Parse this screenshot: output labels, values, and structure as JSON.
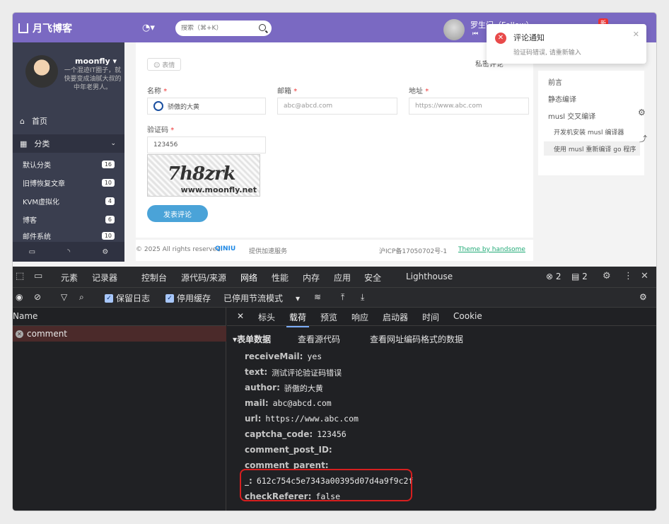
{
  "site": {
    "title": "月飞博客",
    "search_placeholder": "搜索（⌘+K）",
    "user_name": "罗生门（Follow）",
    "user_sub": "⏮",
    "new_badge": "新"
  },
  "sidebar": {
    "profile_name": "moonfly ▾",
    "profile_desc": "一个混迹IT圈子，就快要变成油腻大叔的中年老男人。",
    "home_label": "首页",
    "category_label": "分类",
    "categories": [
      {
        "name": "默认分类",
        "count": "16"
      },
      {
        "name": "旧博恢复文章",
        "count": "10"
      },
      {
        "name": "KVM虚拟化",
        "count": "4"
      },
      {
        "name": "博客",
        "count": "6"
      },
      {
        "name": "邮件系统",
        "count": "10"
      }
    ],
    "bottom_icons": [
      "comment-icon",
      "rss-icon",
      "gear-icon"
    ]
  },
  "form": {
    "emoji_label": "☺ 表情",
    "private_label": "私密评论",
    "name_label": "名称",
    "email_label": "邮箱",
    "url_label": "地址",
    "required_mark": "*",
    "name_value": "骄傲的大黄",
    "email_placeholder": "abc@abcd.com",
    "url_placeholder": "https://www.abc.com",
    "captcha_label": "验证码",
    "captcha_value": "123456",
    "captcha_code": "7h8zrk",
    "captcha_site": "www.moonfly.net",
    "submit_label": "发表评论"
  },
  "footer": {
    "copyright": "© 2025 All rights reserved.",
    "qiniu": "QINIU",
    "cdn_text": "提供加速服务",
    "icp": "沪ICP备17050702号-1",
    "theme": "Theme by handsome"
  },
  "right_panel": {
    "items": [
      "前言",
      "静态编译",
      "musl 交叉编译"
    ],
    "subitems": [
      "开发机安装 musl 编译器",
      "使用 musl 重新编译 go 程序"
    ]
  },
  "notification": {
    "title": "评论通知",
    "message": "验证码错误, 请重新输入"
  },
  "devtools": {
    "tabs": [
      "元素",
      "记录器",
      "控制台",
      "源代码/来源",
      "网络",
      "性能",
      "内存",
      "应用",
      "安全",
      "Lighthouse"
    ],
    "active_tab": "网络",
    "error_count": "2",
    "message_count": "2",
    "toolbar": {
      "preserve_log": "保留日志",
      "disable_cache": "停用缓存",
      "throttling": "已停用节流模式"
    },
    "request_list_header": "Name",
    "request_name": "comment",
    "detail_tabs": [
      "标头",
      "载荷",
      "预览",
      "响应",
      "启动器",
      "时间",
      "Cookie"
    ],
    "active_detail_tab": "载荷",
    "section_title": "▾表单数据",
    "view_source": "查看源代码",
    "view_url_encoded": "查看网址编码格式的数据",
    "payload": [
      {
        "key": "receiveMail:",
        "value": "yes"
      },
      {
        "key": "text:",
        "value": "测试评论验证码错误"
      },
      {
        "key": "author:",
        "value": "骄傲的大黄"
      },
      {
        "key": "mail:",
        "value": "abc@abcd.com"
      },
      {
        "key": "url:",
        "value": "https://www.abc.com"
      },
      {
        "key": "captcha_code:",
        "value": "123456"
      },
      {
        "key": "comment_post_ID:",
        "value": ""
      },
      {
        "key": "comment_parent:",
        "value": ""
      },
      {
        "key": "_:",
        "value": "612c754c5e7343a00395d07d4a9f9c2f"
      },
      {
        "key": "checkReferer:",
        "value": "false"
      }
    ]
  },
  "colors": {
    "topbar": "#7a69c2",
    "sidebar": "#3a3e4f",
    "submit": "#4aa3d8",
    "error": "#e84a4a",
    "highlight_box": "#d61f1f"
  }
}
